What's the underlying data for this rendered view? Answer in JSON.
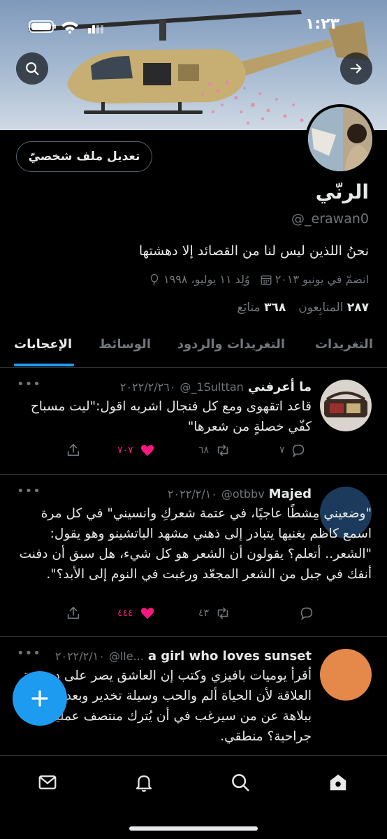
{
  "status_bar": {
    "time": "١:٢٣"
  },
  "profile": {
    "display_name": "الرنّي",
    "handle": "@_erawan0",
    "bio": "نحنُ اللذين ليس لنا من القصائد إلا دهشتها",
    "birthday": "وُلِد ١١ يوليو، ١٩٩٨",
    "joined": "انضمّ في يونيو ٢٠١٣",
    "following_count": "٣٦٨",
    "following_label": "متابَع",
    "followers_count": "٢٨٧",
    "followers_label": "المتابِعون",
    "edit_button_label": "تعديل ملف شخصيّ"
  },
  "tabs": [
    {
      "label": "التغريدات",
      "active": false
    },
    {
      "label": "التغريدات والردود",
      "active": false
    },
    {
      "label": "الوسائط",
      "active": false
    },
    {
      "label": "الإعجابات",
      "active": true
    }
  ],
  "tweets": [
    {
      "name": "ما أعرفني",
      "handle": "@_1Sulttan",
      "date": "٢٠٢٢/٢/٢٦٠",
      "text": "قاعد اتقهوى ومع كل فنجال اشربه اقول:\"ليت مسباح كفّي خصلةٍ من شعرها\"",
      "replies": "٧",
      "retweets": "٦٨",
      "likes": "٧٠٧",
      "more": "•••"
    },
    {
      "name": "Majed",
      "handle": "@otbbv",
      "date": "٢٠٢٢/٢/١٠",
      "text": "\"وضعيني مِشطًا عاجيًا، في عتمة شعركِ وانسيني\" في كل مرة اسمع كاظم يغنيها يتبادر إلى ذهني مشهد الباتشينو وهو يقول: \"الشعر.. أتعلم؟ يقولون أن الشعر هو كل شيء، هل سبق أن دفنت أنفك في جبل من الشعر المجعّد ورغبت في النوم إلى الأبد؟\".",
      "replies": "",
      "retweets": "٤٣",
      "likes": "٤٤٤",
      "more": "•••"
    },
    {
      "name": "a girl who loves sunset",
      "handle": "@lle...",
      "date": "٢٠٢٢/٢/١٠",
      "text": "أقرأ يوميات بافيزي وكتب إن العاشق يصر على ديمومة العلاقة لأن الحياة ألم والحب وسيلة تخدير وبعدها تساءل ببلاهة عن من سيرغب في أن يُترك منتصف عملية جراحية؟ منطقي.",
      "more": "•••"
    }
  ],
  "colors": {
    "accent": "#1d9bf0",
    "like": "#f91880",
    "muted": "#71767b",
    "text": "#e7e9ea",
    "background": "#000000"
  },
  "icons": {
    "banner": [
      "search-icon",
      "arrow-right-icon"
    ],
    "bottom_nav": [
      "mail-icon",
      "bell-icon",
      "search-icon",
      "home-icon"
    ],
    "fab": "plus-icon"
  }
}
